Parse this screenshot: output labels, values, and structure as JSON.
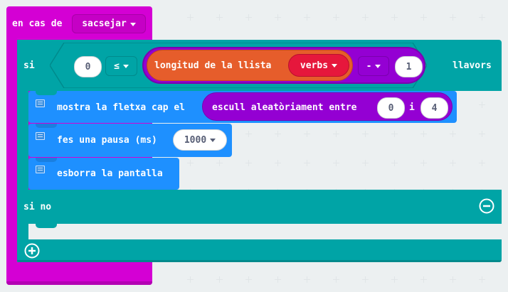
{
  "colors": {
    "event": "#d400d4",
    "logic": "#00a4a6",
    "basic": "#1e90ff",
    "list": "#e65d2b",
    "math": "#9400d3",
    "dropdown_red": "#e6173c"
  },
  "event": {
    "label": "en cas de",
    "gesture": "sacsejar"
  },
  "if_block": {
    "if_label": "si",
    "then_label": "llavors",
    "else_label": "si no"
  },
  "condition": {
    "left": "0",
    "operator": "≤",
    "length_label": "longitud de la llista",
    "list_name": "verbs",
    "minus": "-",
    "right": "1"
  },
  "arrow": {
    "label": "mostra la fletxa cap el",
    "random_label": "escull aleatòriament entre",
    "from": "0",
    "and": "i",
    "to": "4"
  },
  "pause": {
    "label": "fes una pausa (ms)",
    "value": "1000"
  },
  "clear": {
    "label": "esborra la pantalla"
  },
  "icons": {
    "remove": "minus-circle-icon",
    "add": "plus-circle-icon",
    "dropdown": "chevron-down-icon",
    "comment": "comment-icon"
  }
}
